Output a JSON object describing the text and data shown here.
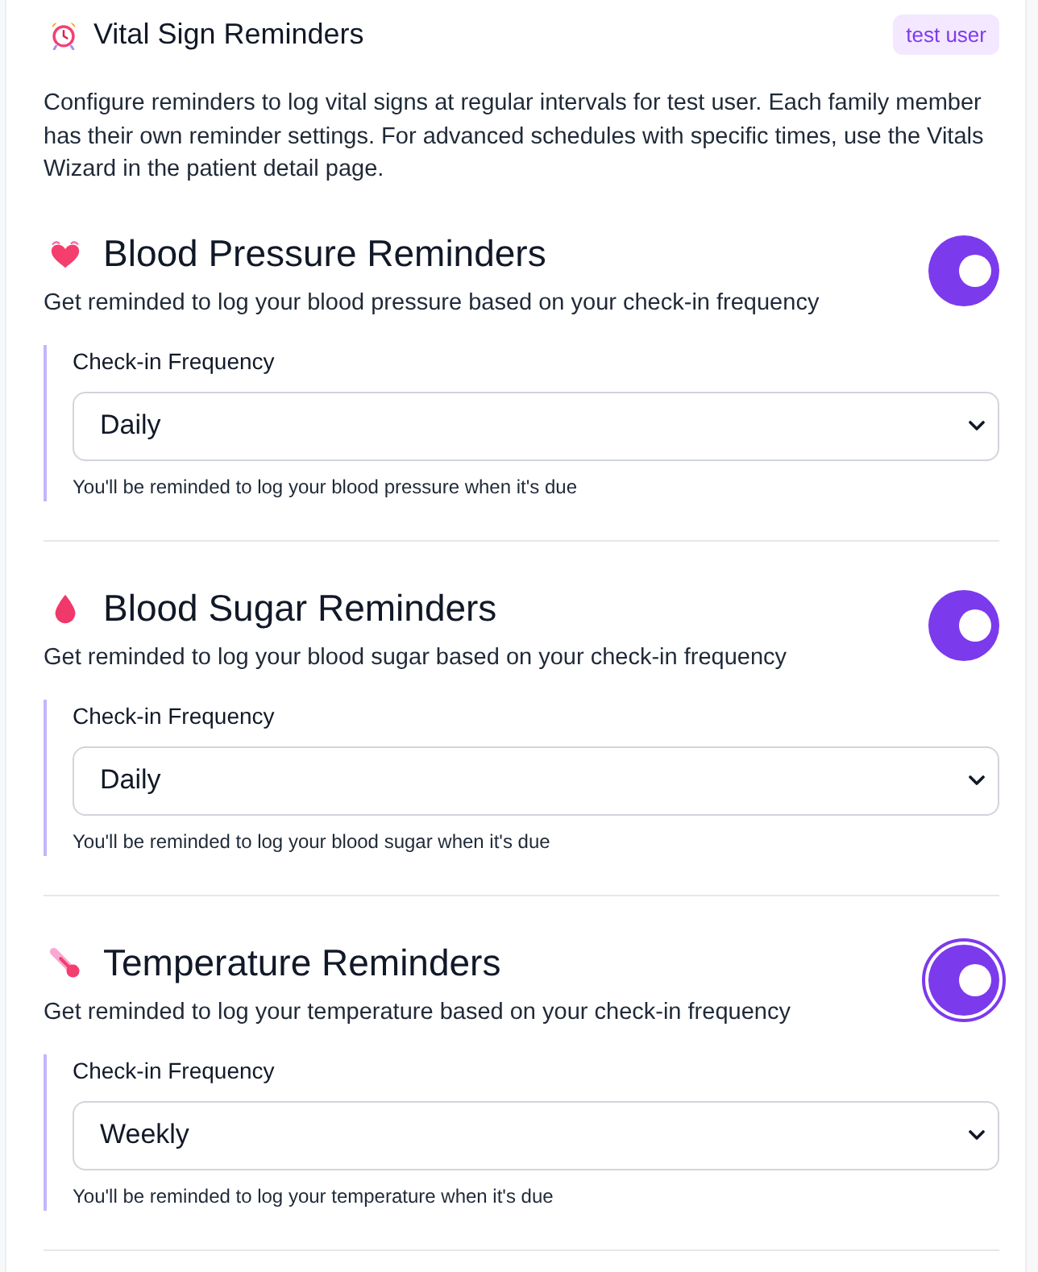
{
  "header": {
    "title": "Vital Sign Reminders",
    "badge": "test user"
  },
  "intro": "Configure reminders to log vital signs at regular intervals for test user. Each family member has their own reminder settings. For advanced schedules with specific times, use the Vitals Wizard in the patient detail page.",
  "sections": [
    {
      "title": "Blood Pressure Reminders",
      "description": "Get reminded to log your blood pressure based on your check-in frequency",
      "toggle": {
        "on": true,
        "focused": false
      },
      "field_label": "Check-in Frequency",
      "frequency": "Daily",
      "help": "You'll be reminded to log your blood pressure when it's due"
    },
    {
      "title": "Blood Sugar Reminders",
      "description": "Get reminded to log your blood sugar based on your check-in frequency",
      "toggle": {
        "on": true,
        "focused": false
      },
      "field_label": "Check-in Frequency",
      "frequency": "Daily",
      "help": "You'll be reminded to log your blood sugar when it's due"
    },
    {
      "title": "Temperature Reminders",
      "description": "Get reminded to log your temperature based on your check-in frequency",
      "toggle": {
        "on": true,
        "focused": true
      },
      "field_label": "Check-in Frequency",
      "frequency": "Weekly",
      "help": "You'll be reminded to log your temperature when it's due"
    }
  ]
}
